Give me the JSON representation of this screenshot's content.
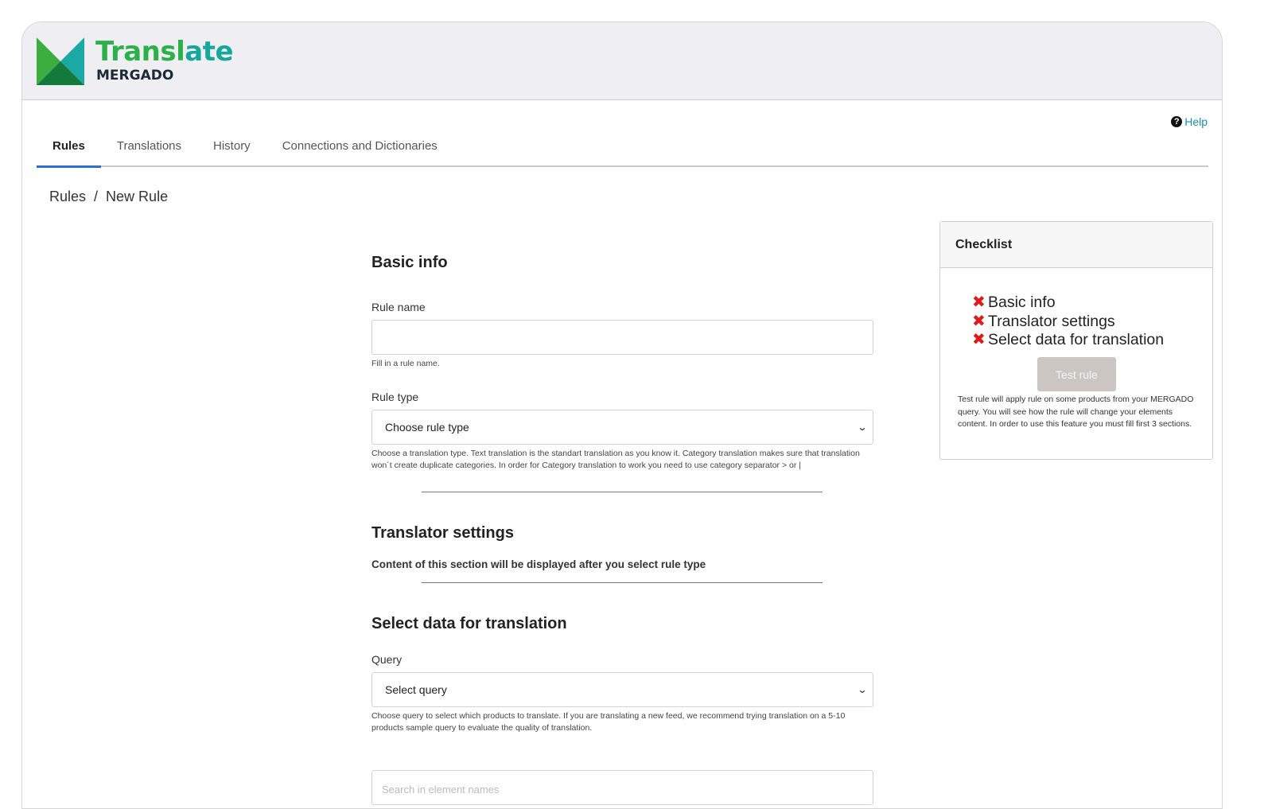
{
  "logo": {
    "word_main": "Transl",
    "word_tail": "ate",
    "sub": "MERGADO"
  },
  "help": {
    "icon": "question-circle-icon",
    "label": "Help"
  },
  "tabs": [
    {
      "label": "Rules",
      "active": true
    },
    {
      "label": "Translations",
      "active": false
    },
    {
      "label": "History",
      "active": false
    },
    {
      "label": "Connections and Dictionaries",
      "active": false
    }
  ],
  "breadcrumb": {
    "root": "Rules",
    "separator": "/",
    "current": "New Rule"
  },
  "basic_info": {
    "title": "Basic info",
    "rule_name_label": "Rule name",
    "rule_name_value": "",
    "rule_name_hint": "Fill in a rule name.",
    "rule_type_label": "Rule type",
    "rule_type_value": "Choose rule type",
    "rule_type_hint": "Choose a translation type. Text translation is the standart translation as you know it. Category translation makes sure that translation won´t create duplicate categories. In order for Category translation to work you need to use category separator > or |"
  },
  "translator_settings": {
    "title": "Translator settings",
    "note": "Content of this section will be displayed after you select rule type"
  },
  "select_data": {
    "title": "Select data for translation",
    "query_label": "Query",
    "query_value": "Select query",
    "query_hint": "Choose query to select which products to translate. If you are translating a new feed, we recommend trying translation on a 5-10 products sample query to evaluate the quality of translation.",
    "search_placeholder": "Search in element names"
  },
  "checklist": {
    "title": "Checklist",
    "items": [
      "Basic info",
      "Translator settings",
      "Select data for translation"
    ],
    "test_button": "Test rule",
    "description": "Test rule will apply rule on some products from your MERGADO query. You will see how the rule will change your elements content. In order to use this feature you must fill first 3 sections."
  },
  "colors": {
    "accent": "#2b6fd6",
    "brand_green": "#2cb04a",
    "brand_teal": "#17a69b",
    "error": "#e01919",
    "link": "#1a8fa8"
  }
}
